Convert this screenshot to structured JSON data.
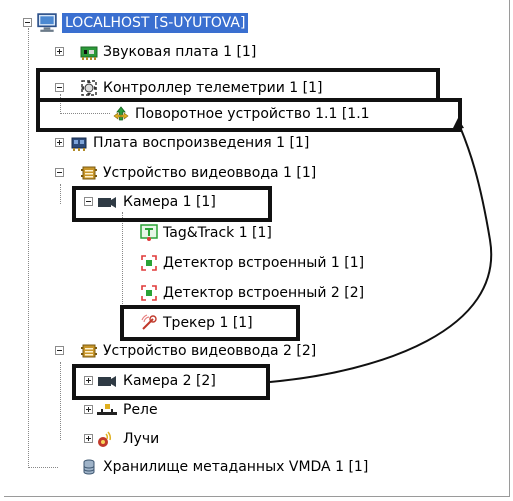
{
  "tree": {
    "root": {
      "label": "LOCALHOST [S-UYUTOVA]",
      "icon": "computer-icon"
    },
    "nodes": [
      {
        "label": "Звуковая плата 1 [1]",
        "icon": "sound-card-icon",
        "expander": "plus"
      },
      {
        "label": "Контроллер телеметрии 1 [1]",
        "icon": "telemetry-controller-icon",
        "expander": "minus"
      },
      {
        "label": "Поворотное устройство 1.1 [1.1",
        "icon": "ptz-device-icon",
        "expander": "none"
      },
      {
        "label": "Плата воспроизведения 1 [1]",
        "icon": "playback-board-icon",
        "expander": "plus"
      },
      {
        "label": "Устройство видеоввода 1 [1]",
        "icon": "video-input-device-icon",
        "expander": "minus"
      },
      {
        "label": "Камера 1 [1]",
        "icon": "camera-icon",
        "expander": "minus"
      },
      {
        "label": "Tag&Track 1 [1]",
        "icon": "tag-track-icon",
        "expander": "none"
      },
      {
        "label": "Детектор встроенный 1 [1]",
        "icon": "detector-icon",
        "expander": "none"
      },
      {
        "label": "Детектор встроенный 2 [2]",
        "icon": "detector-icon",
        "expander": "none"
      },
      {
        "label": "Трекер 1 [1]",
        "icon": "tracker-icon",
        "expander": "none"
      },
      {
        "label": "Устройство видеоввода 2 [2]",
        "icon": "video-input-device-icon",
        "expander": "minus"
      },
      {
        "label": "Камера 2 [2]",
        "icon": "camera-icon",
        "expander": "plus"
      },
      {
        "label": "Реле",
        "icon": "relay-icon",
        "expander": "plus"
      },
      {
        "label": "Лучи",
        "icon": "ray-sensor-icon",
        "expander": "plus"
      },
      {
        "label": "Хранилище метаданных VMDA 1 [1]",
        "icon": "database-icon",
        "expander": "none"
      }
    ]
  },
  "colors": {
    "selection": "#3a6fd0",
    "highlight_frame": "#111111",
    "camera": "#2f3a44",
    "video_device": "#c8962a",
    "green_chip": "#2d9a3a",
    "ptz_green": "#2a9d3a",
    "detector_green": "#2aa336"
  }
}
